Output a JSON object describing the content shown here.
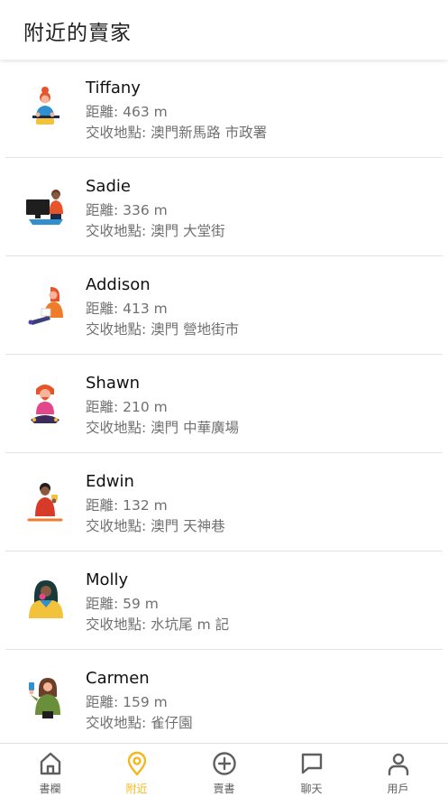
{
  "header": {
    "title": "附近的賣家"
  },
  "sellers": [
    {
      "name": "Tiffany",
      "distance": "距離: 463 m",
      "place": "交收地點: 澳門新馬路 市政署"
    },
    {
      "name": "Sadie",
      "distance": "距離: 336 m",
      "place": "交收地點: 澳門 大堂街"
    },
    {
      "name": "Addison",
      "distance": "距離: 413 m",
      "place": "交收地點: 澳門 營地街市"
    },
    {
      "name": "Shawn",
      "distance": "距離: 210 m",
      "place": "交收地點: 澳門 中華廣場"
    },
    {
      "name": "Edwin",
      "distance": "距離: 132 m",
      "place": "交收地點: 澳門 天神巷"
    },
    {
      "name": "Molly",
      "distance": "距離: 59 m",
      "place": "交收地點: 水坑尾 m 記"
    },
    {
      "name": "Carmen",
      "distance": "距離: 159 m",
      "place": "交收地點: 雀仔園"
    }
  ],
  "tabbar": {
    "tabs": [
      {
        "label": "書欄",
        "icon": "home-icon"
      },
      {
        "label": "附近",
        "icon": "location-pin-icon",
        "active": true
      },
      {
        "label": "賣書",
        "icon": "add-circle-icon"
      },
      {
        "label": "聊天",
        "icon": "chat-bubble-icon"
      },
      {
        "label": "用戶",
        "icon": "user-icon"
      }
    ]
  },
  "colors": {
    "accent": "#f2b81c",
    "text": "#111111",
    "secondary_text": "#707070",
    "divider": "#e3e3e3"
  }
}
